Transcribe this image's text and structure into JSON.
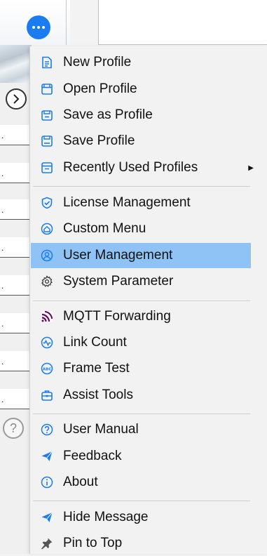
{
  "background": {
    "more_button_icon": "more-dots-icon",
    "nav_icon": "chevron-right-circle-icon",
    "row_marker": ".",
    "help_icon": "question-circle-icon",
    "help_glyph": "?"
  },
  "menu": {
    "accent_color": "#1a7cf0",
    "highlight_color": "#8fc3f5",
    "items": [
      {
        "label": "New Profile",
        "icon": "new-profile-icon"
      },
      {
        "label": "Open Profile",
        "icon": "open-profile-icon"
      },
      {
        "label": "Save as Profile",
        "icon": "save-as-profile-icon"
      },
      {
        "label": "Save Profile",
        "icon": "save-profile-icon"
      },
      {
        "label": "Recently Used Profiles",
        "icon": "recent-profiles-icon",
        "submenu": true
      },
      {
        "label": "License Management",
        "icon": "shield-check-icon"
      },
      {
        "label": "Custom Menu",
        "icon": "home-icon"
      },
      {
        "label": "User Management",
        "icon": "user-circle-icon",
        "highlighted": true
      },
      {
        "label": "System Parameter",
        "icon": "gear-icon"
      },
      {
        "label": "MQTT Forwarding",
        "icon": "mqtt-icon"
      },
      {
        "label": "Link Count",
        "icon": "pulse-icon"
      },
      {
        "label": "Frame Test",
        "icon": "abc-icon"
      },
      {
        "label": "Assist Tools",
        "icon": "toolbox-icon"
      },
      {
        "label": "User Manual",
        "icon": "question-icon"
      },
      {
        "label": "Feedback",
        "icon": "paper-plane-icon"
      },
      {
        "label": "About",
        "icon": "info-icon"
      },
      {
        "label": "Hide Message",
        "icon": "paper-plane-icon"
      },
      {
        "label": "Pin to Top",
        "icon": "pin-icon"
      }
    ]
  }
}
